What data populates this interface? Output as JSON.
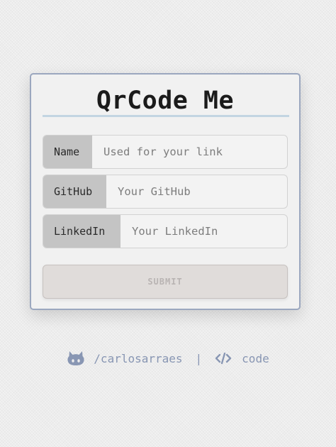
{
  "app": {
    "title": "QrCode Me"
  },
  "form": {
    "fields": [
      {
        "label": "Name",
        "placeholder": "Used for your link",
        "value": ""
      },
      {
        "label": "GitHub",
        "placeholder": "Your GitHub",
        "value": ""
      },
      {
        "label": "LinkedIn",
        "placeholder": "Your LinkedIn",
        "value": ""
      }
    ],
    "submit_label": "SUBMIT"
  },
  "footer": {
    "github_icon": "github-icon",
    "github_text": "/carlosarraes",
    "separator": "|",
    "code_icon": "code-icon",
    "code_text": "code"
  },
  "colors": {
    "accent": "#8896b3",
    "card_border": "#9ba7bf",
    "title_underline": "#c3d5e2",
    "addon_bg": "#c4c4c4",
    "submit_bg": "#e0dcda"
  }
}
